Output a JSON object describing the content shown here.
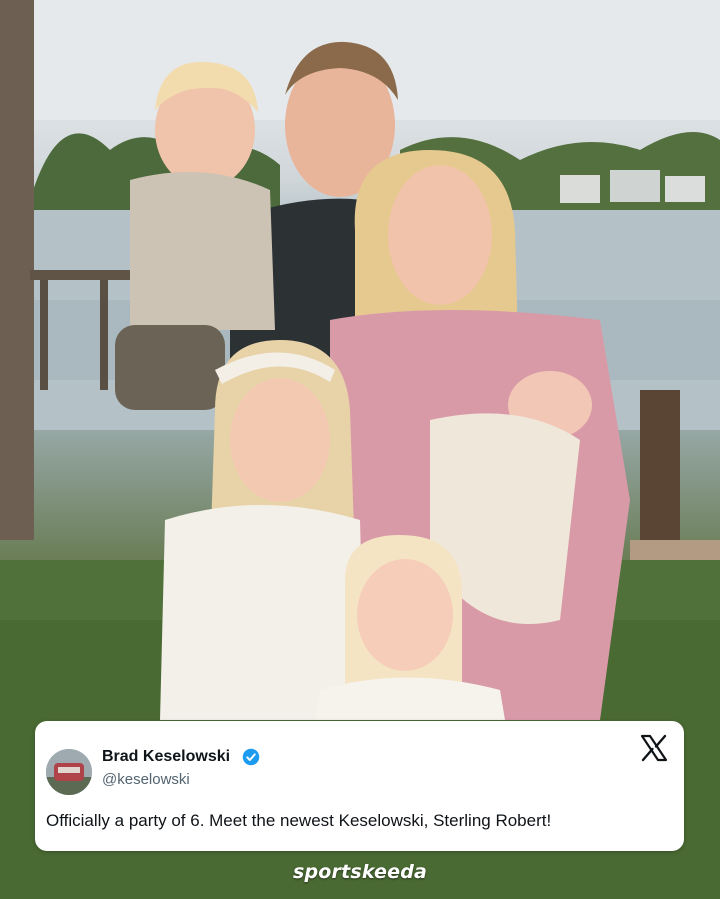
{
  "photo": {
    "description_icon": "family-photo"
  },
  "tweet": {
    "display_name": "Brad Keselowski",
    "handle": "@keselowski",
    "verified": true,
    "text": "Officially a party of 6. Meet the newest Keselowski, Sterling Robert!",
    "platform_icon": "x-logo-icon",
    "verified_color": "#1d9bf0"
  },
  "branding": {
    "watermark": "sportskeeda"
  }
}
